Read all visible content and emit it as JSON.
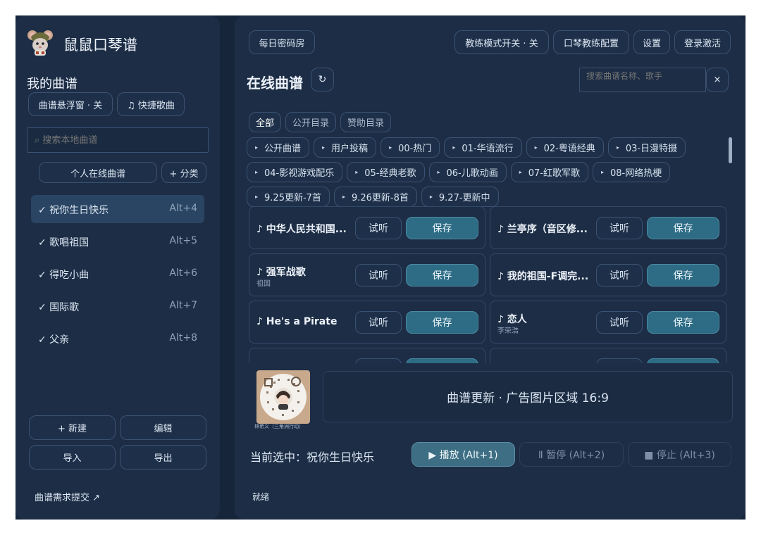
{
  "colors": {
    "background": "#16253a",
    "panel": "#1c2d45",
    "selected": "#2a4563",
    "accent": "#2e6c85"
  },
  "app": {
    "title": "鼠鼠口琴谱",
    "logo_icon": "mouse-mascot-icon"
  },
  "sidebar": {
    "section_title": "我的曲谱",
    "float_window_btn": "曲谱悬浮窗 · 关",
    "quick_song_btn": "♫ 快捷歌曲",
    "search_placeholder": "⌕ 搜索本地曲谱",
    "personal_online_btn": "个人在线曲谱",
    "category_btn": "+ 分类",
    "songs": [
      {
        "name": "✓ 祝你生日快乐",
        "key": "Alt+4",
        "selected": true
      },
      {
        "name": "✓ 歌唱祖国",
        "key": "Alt+5"
      },
      {
        "name": "✓ 得吃小曲",
        "key": "Alt+6"
      },
      {
        "name": "✓ 国际歌",
        "key": "Alt+7"
      },
      {
        "name": "✓ 父亲",
        "key": "Alt+8"
      }
    ],
    "new_btn": "+ 新建",
    "edit_btn": "编辑",
    "import_btn": "导入",
    "export_btn": "导出",
    "request_link": "曲谱需求提交 ↗"
  },
  "header": {
    "daily_room_btn": "每日密码房",
    "coach_toggle_btn": "教练模式开关 · 关",
    "coach_config_btn": "口琴教练配置",
    "settings_btn": "设置",
    "login_btn": "登录激活"
  },
  "online": {
    "title": "在线曲谱",
    "refresh_icon": "↻",
    "search_placeholder": "搜索曲谱名称、歌手",
    "clear_icon": "×",
    "tabs": [
      {
        "label": "全部",
        "active": true
      },
      {
        "label": "公开目录"
      },
      {
        "label": "赞助目录"
      }
    ],
    "categories": [
      [
        "公开曲谱",
        "用户投稿",
        "00-热门",
        "01-华语流行",
        "02-粤语经典",
        "03-日漫特摄"
      ],
      [
        "04-影视游戏配乐",
        "05-经典老歌",
        "06-儿歌动画",
        "07-红歌军歌",
        "08-网络热梗"
      ],
      [
        "9.25更新-7首",
        "9.26更新-8首",
        "9.27-更新中"
      ]
    ],
    "try_label": "试听",
    "save_label": "保存",
    "songs": [
      {
        "title": "♪ 中华人民共和国...",
        "artist": ""
      },
      {
        "title": "♪ 兰亭序（音区修...",
        "artist": ""
      },
      {
        "title": "♪ 强军战歌",
        "artist": "祖国"
      },
      {
        "title": "♪ 我的祖国-F调完...",
        "artist": ""
      },
      {
        "title": "♪ He's a Pirate",
        "artist": ""
      },
      {
        "title": "♪ 恋人",
        "artist": "李荣浩"
      }
    ]
  },
  "ad": {
    "qr_caption": "林希义（三角洲行动）",
    "banner_text": "曲谱更新 · 广告图片区域 16:9"
  },
  "player": {
    "current_prefix": "当前选中：",
    "current_song": "祝你生日快乐",
    "play_btn": "▶ 播放 (Alt+1)",
    "pause_btn": "Ⅱ 暂停 (Alt+2)",
    "stop_btn": "■ 停止 (Alt+3)"
  },
  "status": {
    "text": "就绪"
  }
}
